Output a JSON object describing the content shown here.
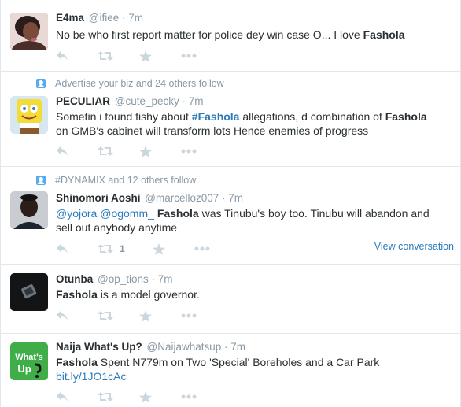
{
  "tweets": [
    {
      "fullname": "E4ma",
      "username": "@ifiee",
      "time": "· 7m",
      "text": [
        "No be who first report matter for police dey win case O... I love ",
        "Fashola"
      ]
    },
    {
      "context": "Advertise your biz and 24 others follow",
      "fullname": "PECULIAR",
      "username": "@cute_pecky",
      "time": "· 7m",
      "text": [
        "Sometin i found fishy about  ",
        "#Fashola",
        " allegations, d combination of ",
        "Fashola",
        "on GMB's cabinet will transform lots Hence enemies of progress"
      ]
    },
    {
      "context": "#DYNAMIX and 12 others follow",
      "fullname": "Shinomori Aoshi",
      "username": "@marcelloz007",
      "time": "· 7m",
      "text": [
        "@yojora",
        " ",
        "@ogomm_",
        " ",
        "Fashola",
        " was Tinubu's boy too. Tinubu will abandon and",
        "sell out anybody anytime"
      ],
      "retweet_count": "1",
      "view_conversation": "View conversation"
    },
    {
      "fullname": "Otunba",
      "username": "@op_tions",
      "time": "· 7m",
      "text": [
        "Fashola",
        " is a model governor."
      ]
    },
    {
      "fullname": "Naija What's Up?",
      "username": "@Naijawhatsup",
      "time": "· 7m",
      "text": [
        "Fashola",
        " Spent N779m on Two 'Special' Boreholes and a Car Park",
        "bit.ly/1JO1cAc"
      ],
      "avatar_text": [
        "What's",
        "Up"
      ]
    }
  ],
  "icons": [
    "reply-icon",
    "retweet-icon",
    "favorite-icon",
    "more-icon",
    "follow-context-icon"
  ],
  "colors": {
    "link": "#2b7bb9",
    "muted": "#8899a6",
    "action": "#ccd6dd",
    "border": "#e1e8ed",
    "brand_green": "#3fae49"
  }
}
